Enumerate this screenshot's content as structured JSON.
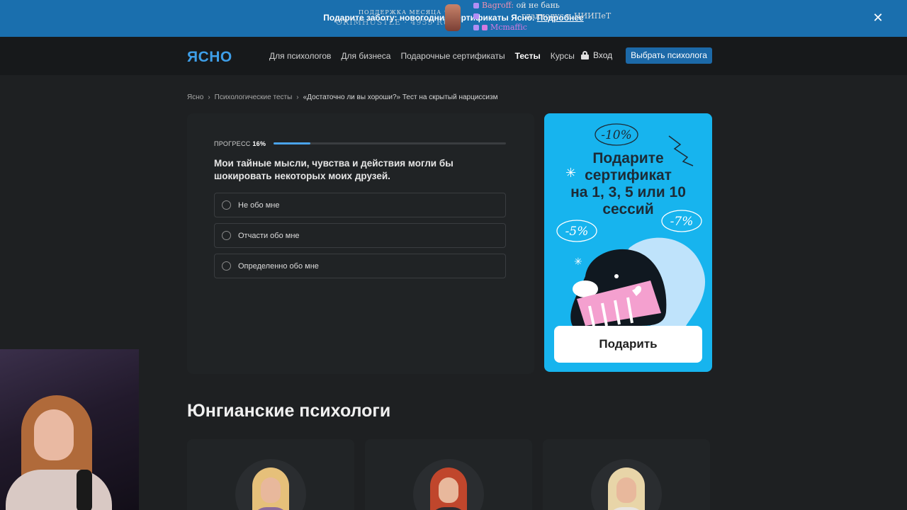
{
  "banner": {
    "text": "Подарите заботу: новогодние сертификаты Ясно.",
    "more_link": "Подробнее"
  },
  "overlay": {
    "support_title": "ПОДДЕРЖКА МЕСЯЦА ♡",
    "support_amount": "ORIMHUSTLE · 4955 RUB",
    "chat": [
      {
        "nick": "Bagroff:",
        "text": "ой не бань"
      },
      {
        "nick": "",
        "text": "гладиолус и НИИПеТ"
      },
      {
        "nick": "Mcmaffic",
        "text": ""
      }
    ]
  },
  "header": {
    "logo": "ЯСНО",
    "nav": [
      "Для психологов",
      "Для бизнеса",
      "Подарочные сертификаты",
      "Тесты",
      "Курсы"
    ],
    "login": "Вход",
    "cta": "Выбрать психолога"
  },
  "breadcrumb": {
    "items": [
      "Ясно",
      "Психологические тесты",
      "«Достаточно ли вы хороши?» Тест на скрытый нарциссизм"
    ]
  },
  "test": {
    "progress_label": "ПРОГРЕСС",
    "progress_value": "16%",
    "progress_fraction": 0.16,
    "question": "Мои тайные мысли, чувства и действия могли бы шокировать некоторых моих друзей.",
    "options": [
      "Не обо мне",
      "Отчасти обо мне",
      "Определенно обо мне"
    ]
  },
  "promo": {
    "title_lines": [
      "Подарите",
      "сертификат",
      "на 1, 3, 5 или 10",
      "сессий"
    ],
    "discounts": [
      "-10%",
      "-5%",
      "-7%"
    ],
    "button": "Подарить"
  },
  "section": {
    "title": "Юнгианские психологи"
  },
  "colors": {
    "accent": "#3e9ee8",
    "cta": "#1c69a8",
    "promo_bg": "#17b4ee",
    "banner_bg": "#1a6fae"
  }
}
